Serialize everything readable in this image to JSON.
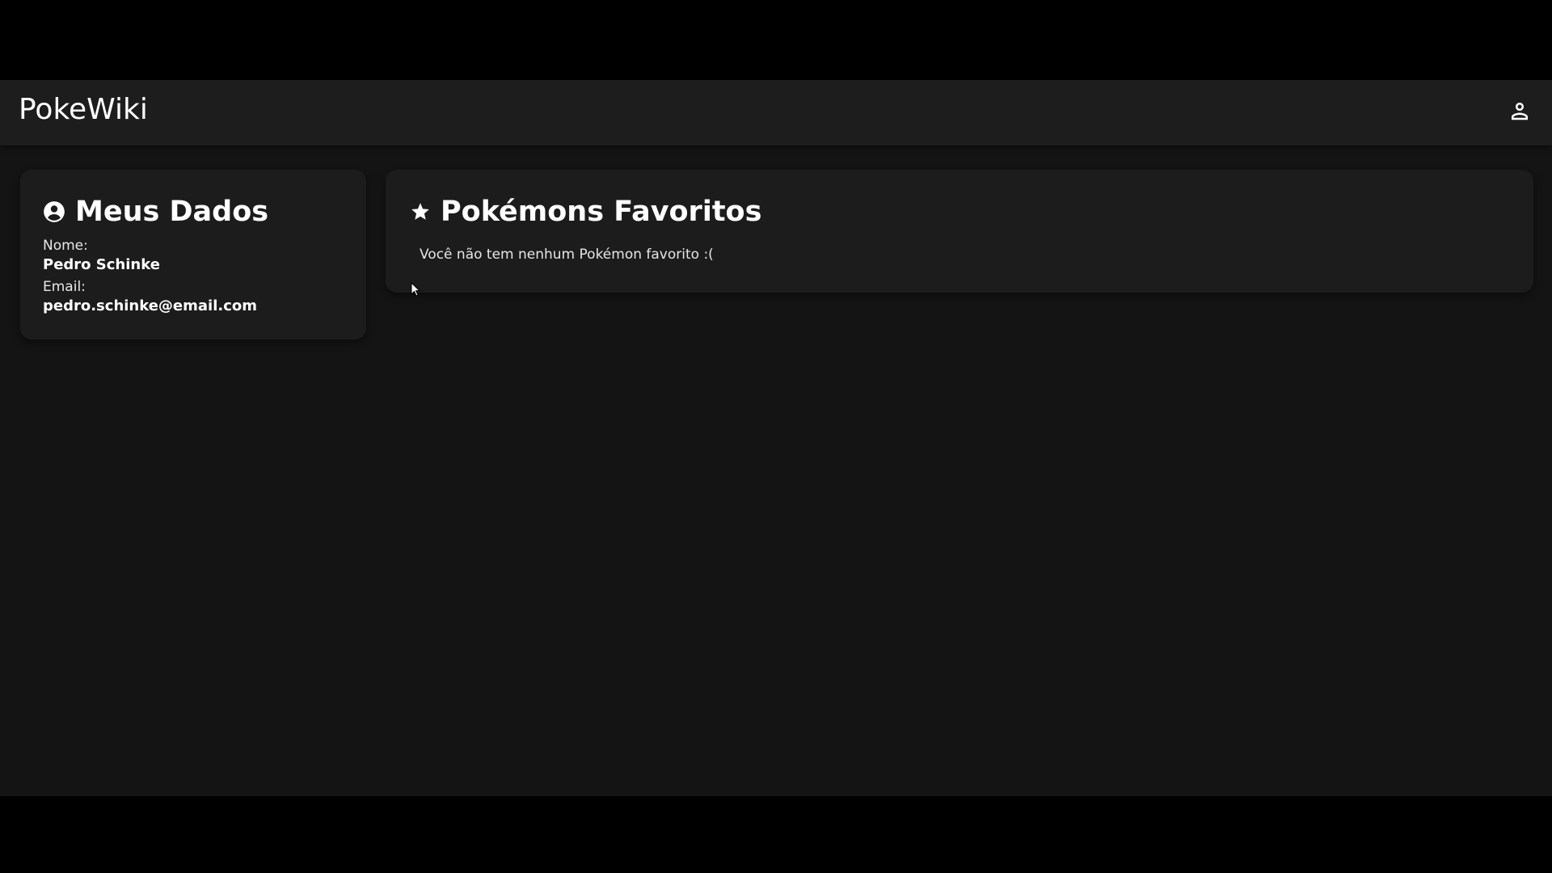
{
  "app": {
    "brand": "PokeWiki",
    "account_icon": "person-icon"
  },
  "profile": {
    "title": "Meus Dados",
    "title_icon": "account-circle-icon",
    "name_label": "Nome:",
    "name_value": "Pedro Schinke",
    "email_label": "Email:",
    "email_value": "pedro.schinke@email.com"
  },
  "favorites": {
    "title": "Pokémons Favoritos",
    "title_icon": "star-icon",
    "empty_message": "Você não tem nenhum Pokémon favorito :("
  },
  "colors": {
    "page_background": "#141414",
    "topbar_background": "#1d1d1d",
    "card_background": "#1c1c1c",
    "text": "#ffffff"
  }
}
